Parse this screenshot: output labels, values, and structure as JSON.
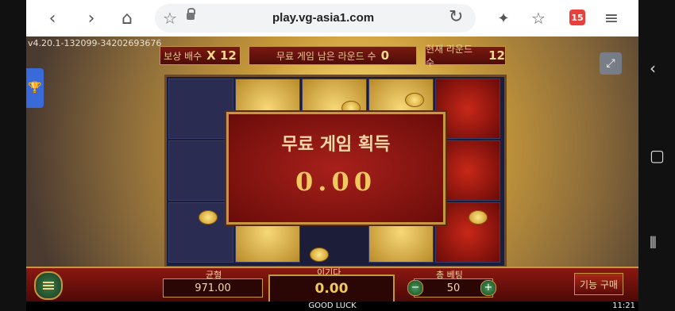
{
  "browser": {
    "url": "play.vg-asia1.com",
    "tabs_count": "15",
    "icons": [
      "back-icon",
      "forward-icon",
      "home-icon",
      "bookmark-star-icon",
      "lock-icon",
      "reload-icon",
      "sparkle-icon",
      "favorites-icon",
      "tabs-icon",
      "menu-icon"
    ]
  },
  "game": {
    "version": "v4.20.1-132099-34202693676",
    "top_left_label": "보상 배수",
    "top_left_value": "X 12",
    "top_center_label": "무료 게임 남은 라운드 수",
    "top_center_value": "0",
    "top_right_label": "현재 라운드 수",
    "top_right_value": "12",
    "popup_title": "무료 게임 획득",
    "popup_amount": "0.00"
  },
  "bottombar": {
    "balance_label": "균형",
    "balance_value": "971.00",
    "win_label": "이기다",
    "win_value": "0.00",
    "bet_label": "총 베팅",
    "bet_value": "50",
    "minus": "−",
    "plus": "+",
    "buy_label": "기능 구매",
    "good_luck": "GOOD LUCK",
    "clock": "11:21"
  }
}
